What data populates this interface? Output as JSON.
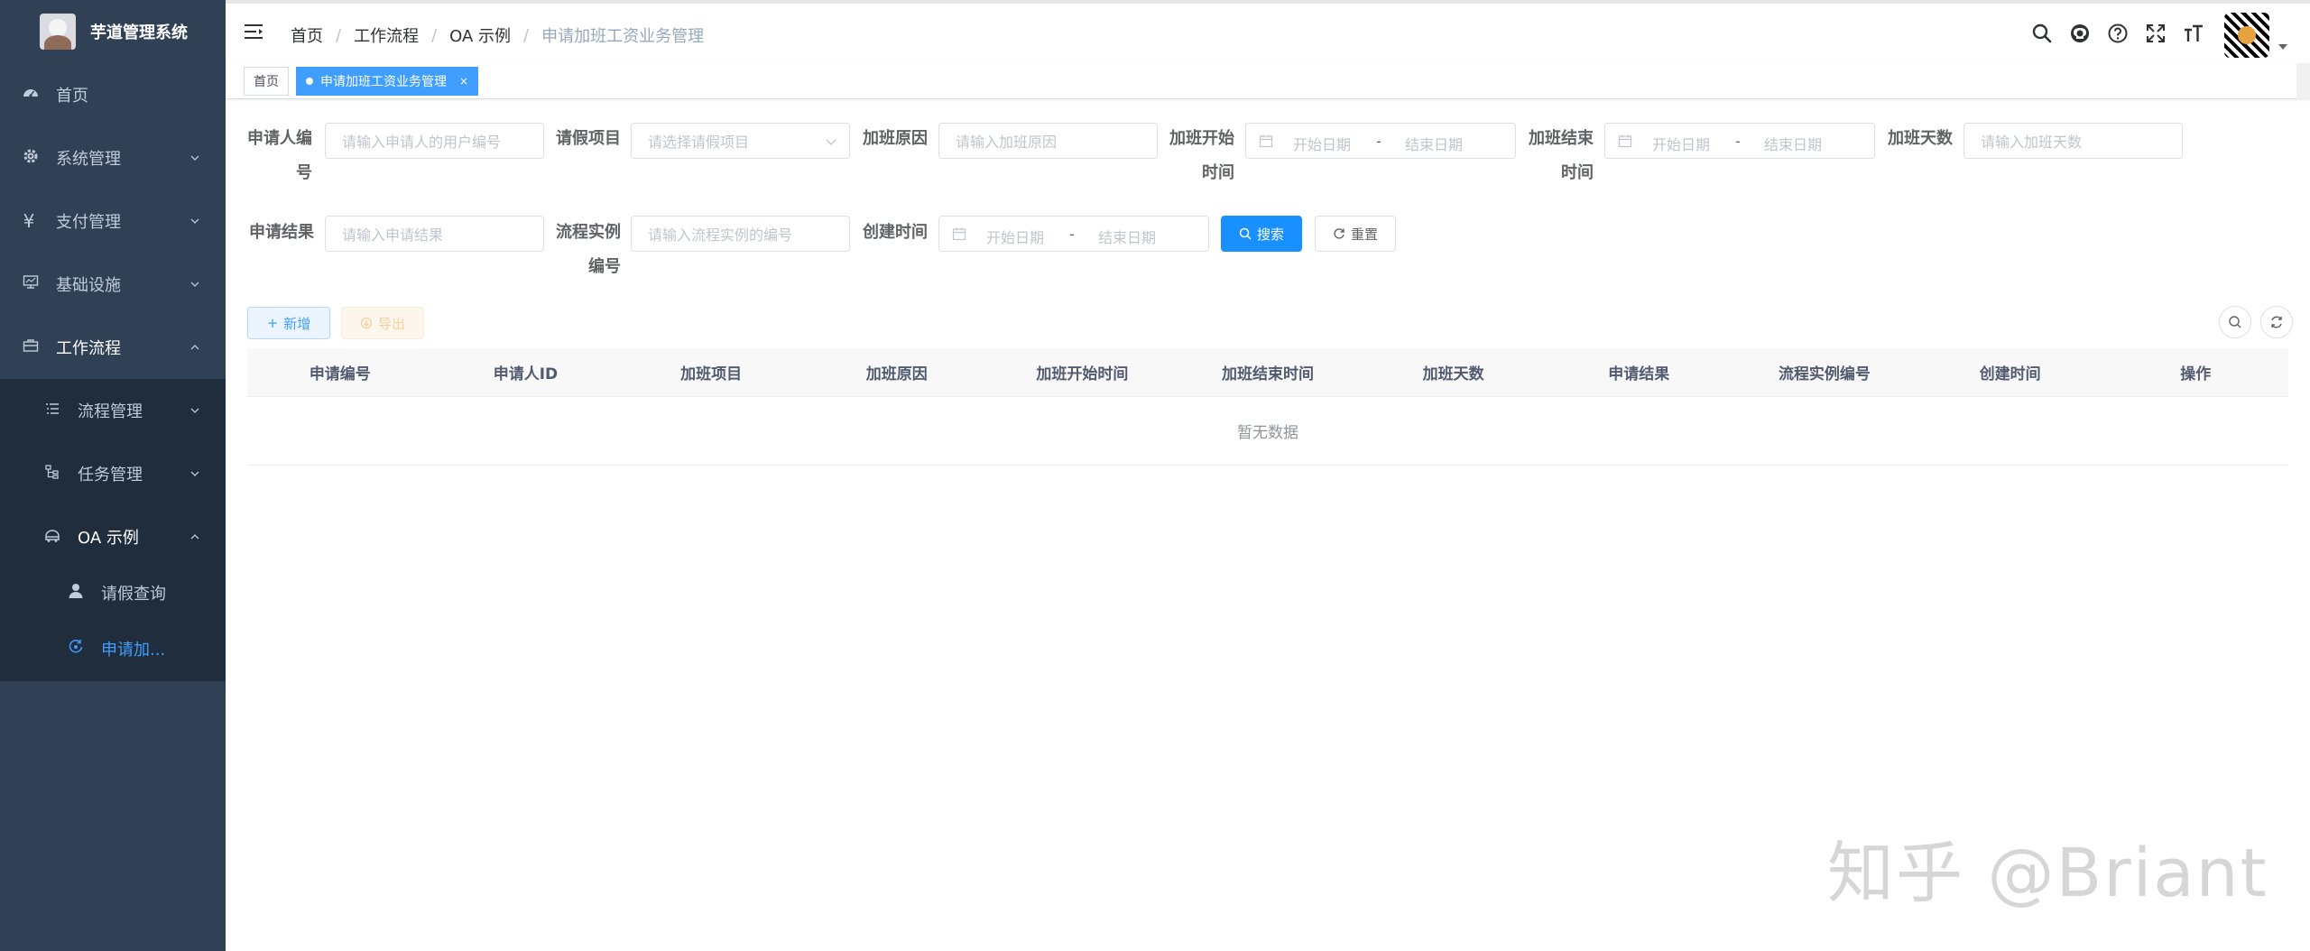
{
  "app": {
    "title": "芋道管理系统"
  },
  "sidebar": {
    "items": [
      {
        "label": "首页",
        "icon": "dashboard-icon"
      },
      {
        "label": "系统管理",
        "icon": "gear-icon"
      },
      {
        "label": "支付管理",
        "icon": "yen-icon"
      },
      {
        "label": "基础设施",
        "icon": "monitor-icon"
      },
      {
        "label": "工作流程",
        "icon": "briefcase-icon"
      },
      {
        "label": "流程管理",
        "icon": "list-icon"
      },
      {
        "label": "任务管理",
        "icon": "tree-icon"
      },
      {
        "label": "OA 示例",
        "icon": "oa-icon"
      },
      {
        "label": "请假查询",
        "icon": "user-icon"
      },
      {
        "label": "申请加...",
        "icon": "process-icon"
      }
    ]
  },
  "navbar": {
    "breadcrumb": [
      "首页",
      "工作流程",
      "OA 示例",
      "申请加班工资业务管理"
    ],
    "icons": [
      "search-icon",
      "github-icon",
      "question-icon",
      "fullscreen-icon",
      "font-size-icon"
    ]
  },
  "tags": {
    "home": "首页",
    "active": "申请加班工资业务管理",
    "close": "×"
  },
  "form": {
    "applicant_label": "申请人编号",
    "applicant_placeholder": "请输入申请人的用户编号",
    "leave_item_label": "请假项目",
    "leave_item_placeholder": "请选择请假项目",
    "reason_label": "加班原因",
    "reason_placeholder": "请输入加班原因",
    "ot_start_label": "加班开始时间",
    "ot_end_label": "加班结束时间",
    "days_label": "加班天数",
    "days_placeholder": "请输入加班天数",
    "result_label": "申请结果",
    "result_placeholder": "请输入申请结果",
    "process_label": "流程实例编号",
    "process_placeholder": "请输入流程实例的编号",
    "created_label": "创建时间",
    "start_date": "开始日期",
    "end_date": "结束日期",
    "dash": "-",
    "search_btn": "搜索",
    "reset_btn": "重置"
  },
  "toolbar": {
    "add_btn": "新增",
    "export_btn": "导出"
  },
  "table": {
    "columns": [
      "申请编号",
      "申请人ID",
      "加班项目",
      "加班原因",
      "加班开始时间",
      "加班结束时间",
      "加班天数",
      "申请结果",
      "流程实例编号",
      "创建时间",
      "操作"
    ],
    "empty_text": "暂无数据"
  },
  "watermark": "知乎 @Briant",
  "colors": {
    "sidebar_bg": "#304156",
    "submenu_bg": "#1f2d3d",
    "primary": "#1890ff",
    "active_menu": "#409eff"
  }
}
